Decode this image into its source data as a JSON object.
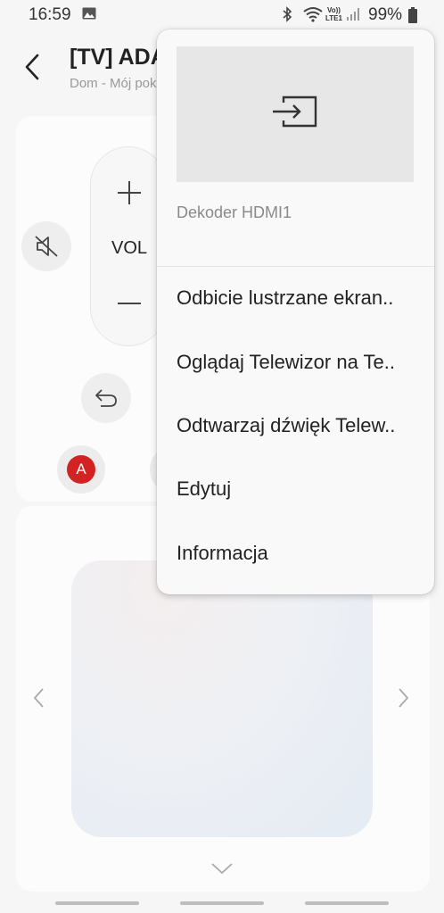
{
  "status_bar": {
    "time": "16:59",
    "lte_top": "Vo))",
    "lte_bottom": "LTE1",
    "battery": "99%"
  },
  "header": {
    "title": "[TV] ADAM",
    "subtitle": "Dom - Mój pokój"
  },
  "remote": {
    "vol_label": "VOL",
    "a_button": "A"
  },
  "menu": {
    "source_label": "Dekoder HDMI1",
    "items": [
      {
        "label": "Odbicie lustrzane ekran.."
      },
      {
        "label": "Oglądaj Telewizor na Te.."
      },
      {
        "label": "Odtwarzaj dźwięk Telew.."
      },
      {
        "label": "Edytuj"
      },
      {
        "label": "Informacja"
      }
    ]
  },
  "colors": {
    "accent_red": "#d32222",
    "background": "#f6f6f6"
  }
}
